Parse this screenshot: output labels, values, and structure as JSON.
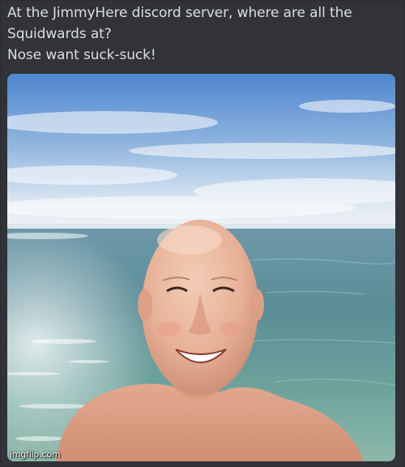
{
  "message": {
    "lines": [
      "At the JimmyHere discord server, where are all the",
      "Squidwards at?",
      "Nose want suck-suck!"
    ]
  },
  "attachment": {
    "subject": "bald man smiling selfie at the beach",
    "colors": {
      "sky_top": "#5c8fd0",
      "sky_horizon": "#e6eef4",
      "sea": "#6f9aa3",
      "skin": "#e9b89e"
    }
  },
  "watermark": {
    "text": "imgflip.com"
  }
}
